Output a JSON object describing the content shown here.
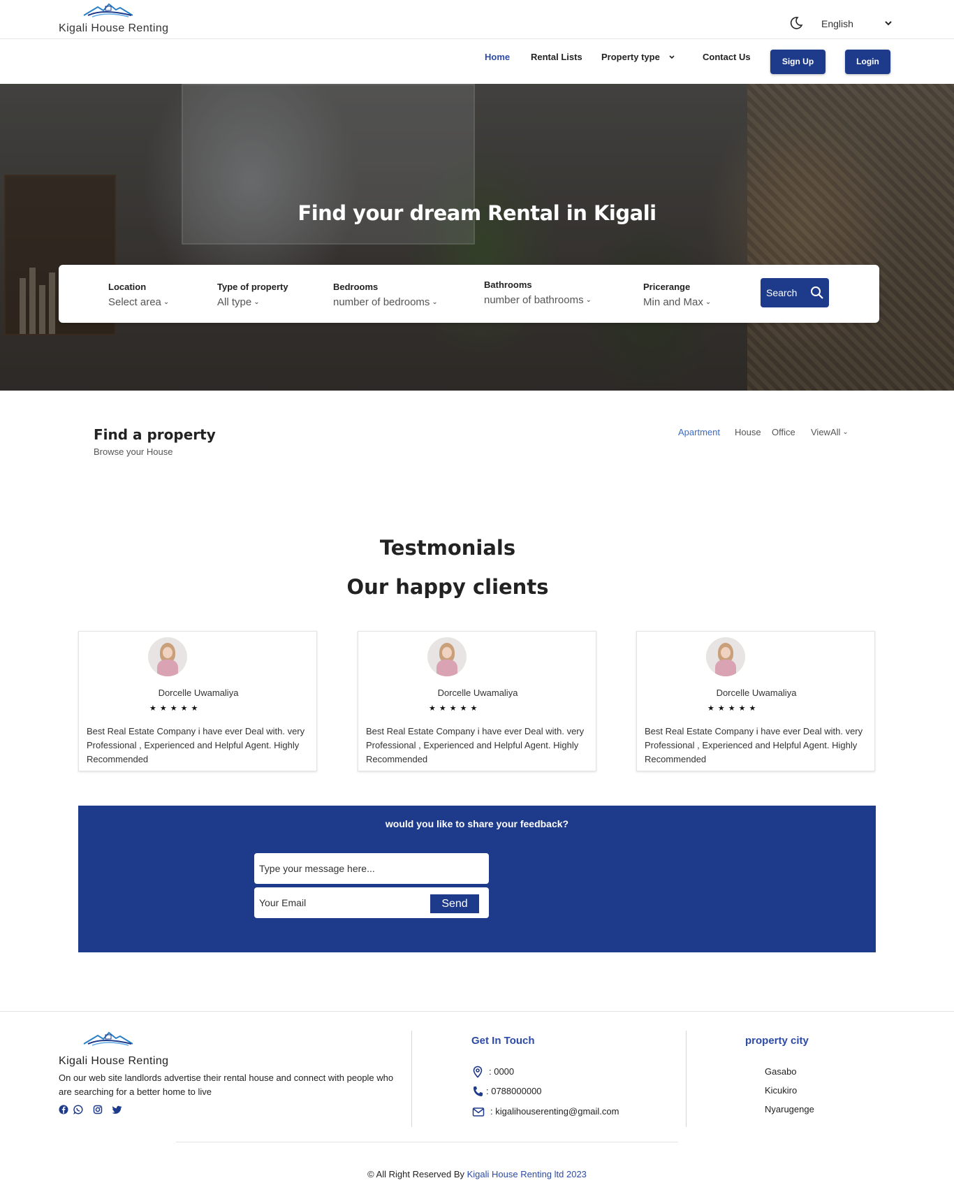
{
  "brand": {
    "name": "Kigali House Renting"
  },
  "header": {
    "language": "English"
  },
  "nav": {
    "home": "Home",
    "rental_lists": "Rental Lists",
    "property_type": "Property type",
    "contact": "Contact Us",
    "sign_up": "Sign Up",
    "login": "Login"
  },
  "hero": {
    "title": "Find your dream Rental in Kigali"
  },
  "search": {
    "location_label": "Location",
    "location_value": "Select area",
    "type_label": "Type of property",
    "type_value": "All type",
    "bedrooms_label": "Bedrooms",
    "bedrooms_value": "number of bedrooms",
    "bathrooms_label": "Bathrooms",
    "bathrooms_value": "number of bathrooms",
    "price_label": "Pricerange",
    "price_value": "Min and Max",
    "button": "Search"
  },
  "find_property": {
    "title": "Find a property",
    "subtitle": "Browse your House",
    "tabs": [
      "Apartment",
      "House",
      "Office",
      "ViewAll"
    ]
  },
  "testimonials": {
    "title": "Testmonials",
    "subtitle": "Our happy clients",
    "items": [
      {
        "name": "Dorcelle Uwamaliya",
        "stars": "★★★★★",
        "text": "Best Real Estate Company i have ever Deal with. very Professional , Experienced and Helpful Agent. Highly Recommended"
      },
      {
        "name": "Dorcelle Uwamaliya",
        "stars": "★★★★★",
        "text": "Best Real Estate Company i have ever Deal with. very Professional , Experienced and Helpful Agent. Highly Recommended"
      },
      {
        "name": "Dorcelle Uwamaliya",
        "stars": "★★★★★",
        "text": "Best Real Estate Company i have ever Deal with. very Professional , Experienced and Helpful Agent. Highly Recommended"
      }
    ]
  },
  "feedback": {
    "title": "would you like to share your feedback?",
    "message_placeholder": "Type your message here...",
    "email_placeholder": "Your Email",
    "send": "Send"
  },
  "footer": {
    "brand": "Kigali House Renting",
    "description": "On our web site landlords advertise their rental house and connect with people who are searching for a better home to live",
    "contact_title": "Get In Touch",
    "address": ": 0000",
    "phone": ": 0788000000",
    "email": ": kigalihouserenting@gmail.com",
    "city_title": "property city",
    "cities": [
      "Gasabo",
      "Kicukiro",
      "Nyarugenge"
    ],
    "copyright_prefix": "©  All Right Reserved By",
    "copyright_brand": "Kigali House Renting ltd 2023"
  },
  "colors": {
    "primary": "#1e3a8a",
    "link": "#2c4aa6"
  }
}
